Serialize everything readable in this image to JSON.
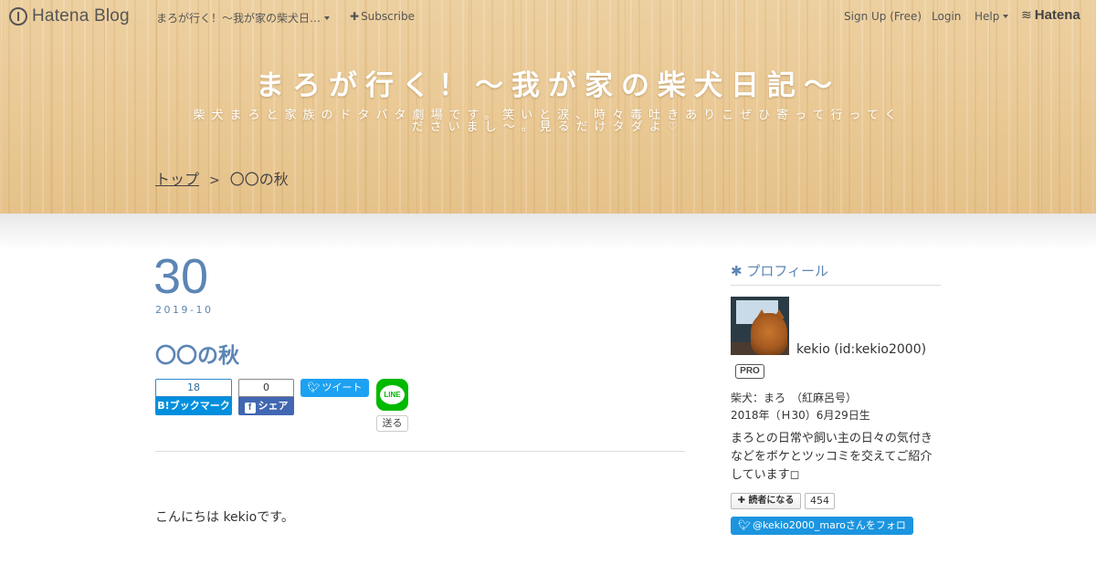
{
  "colors": {
    "accent": "#5b85b5",
    "hero": "#e9c892",
    "hatena_bookmark": "#008fde",
    "facebook": "#4267b2",
    "twitter": "#1da1f2",
    "line": "#00b900"
  },
  "topbar": {
    "logo_text": "Hatena Blog",
    "blog_dropdown": "まろが行く！～我が家の柴犬日…",
    "subscribe": "Subscribe",
    "signup": "Sign Up (Free)",
    "login": "Login",
    "help": "Help",
    "hatena_logo": "Hatena"
  },
  "header": {
    "title": "まろが行く！～我が家の柴犬日記～",
    "description_line1": "柴犬まろと家族のドタバタ劇場です。笑いと涙、時々毒吐きありこぜひ寄って行ってく",
    "description_line2": "ださいまし～。見るだけタダよ♡",
    "breadcrumb_home": "トップ",
    "breadcrumb_sep": ">",
    "breadcrumb_current": "〇〇の秋"
  },
  "entry": {
    "day": "30",
    "year_month": "2019-10",
    "title": "〇〇の秋",
    "body_first_line": "こんにちは kekioです。"
  },
  "share": {
    "bookmark_count": "18",
    "bookmark_label": "B!ブックマーク",
    "facebook_count": "0",
    "facebook_label": "シェア",
    "tweet_label": "ツイート",
    "line_logo": "LINE",
    "line_send": "送る"
  },
  "sidebar": {
    "section_title": "プロフィール",
    "profile_name": "kekio (id:kekio2000)",
    "pro_badge": "PRO",
    "line1": "柴犬：まろ　（紅麻呂号）",
    "line2": "2018年（Ｈ30）6月29日生",
    "description": "まろとの日常や飼い主の日々の気付きなどをボケとツッコミを交えてご紹介しています◻",
    "subscribe_label": "読者になる",
    "subscribe_count": "454",
    "follow_label": "@kekio2000_maroさんをフォロー"
  }
}
